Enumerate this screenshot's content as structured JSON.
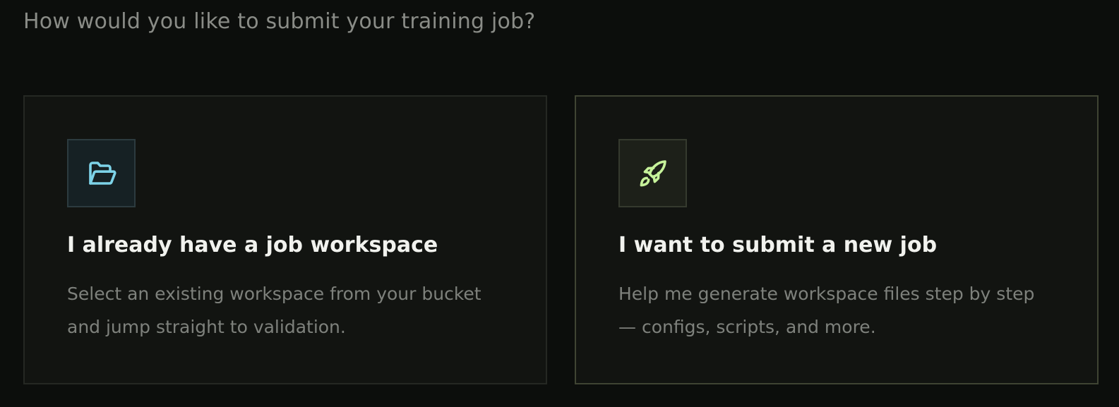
{
  "prompt": {
    "question": "How would you like to submit your training job?"
  },
  "options": [
    {
      "icon": "folder-open-icon",
      "title": "I already have a job workspace",
      "description": "Select an existing workspace from your bucket and jump straight to validation."
    },
    {
      "icon": "rocket-icon",
      "title": "I want to submit a new job",
      "description": "Help me generate workspace files step by step — configs, scripts, and more."
    }
  ],
  "colors": {
    "background": "#0c0e0c",
    "card_background": "#121411",
    "folder_icon": "#7dd3e8",
    "rocket_icon": "#c6f29a",
    "selected_border": "#3f4433"
  }
}
